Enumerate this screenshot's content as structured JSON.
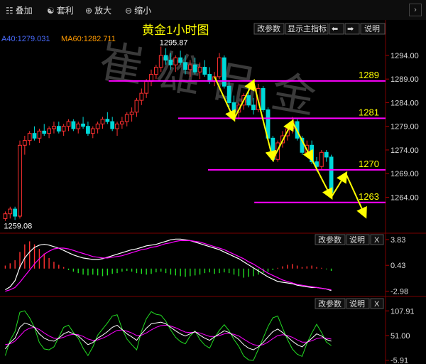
{
  "toolbar": {
    "overlay": "叠加",
    "arbitrage": "套利",
    "zoom_in": "放大",
    "zoom_out": "缩小",
    "next": "›"
  },
  "main_panel": {
    "title": "黄金1小时图",
    "ma_label_a": "A40:1279.031",
    "ma_label_b": "MA60:1282.711",
    "buttons": {
      "params": "改参数",
      "main_indicator": "显示主指标",
      "left": "⬅",
      "right": "➡",
      "help": "说明"
    },
    "watermark": "崔雄品金"
  },
  "macd_panel": {
    "buttons": {
      "params": "改参数",
      "help": "说明",
      "close": "X"
    }
  },
  "kdj_panel": {
    "buttons": {
      "params": "改参数",
      "help": "说明",
      "close": "X"
    }
  },
  "colors": {
    "up": "#ff3030",
    "down": "#00d8d8",
    "magenta": "#ff00ff",
    "yellow": "#ffff00",
    "white": "#ffffff",
    "green": "#22dd22"
  },
  "chart_data": [
    {
      "type": "candlestick",
      "title": "黄金1小时图",
      "ylim": [
        1257,
        1297
      ],
      "y_ticks": [
        1294.0,
        1289.0,
        1284.0,
        1279.0,
        1274.0,
        1269.0,
        1264.0
      ],
      "annotations": {
        "high": "1295.87",
        "low": "1259.08"
      },
      "ohlc": [
        [
          1259.5,
          1261,
          1259,
          1260.5
        ],
        [
          1260.5,
          1262,
          1259.5,
          1261.5
        ],
        [
          1261.5,
          1262,
          1259.2,
          1260
        ],
        [
          1260,
          1276,
          1259.5,
          1275
        ],
        [
          1275,
          1277,
          1273,
          1276
        ],
        [
          1276,
          1278,
          1275,
          1277.5
        ],
        [
          1277.5,
          1279,
          1276,
          1276.5
        ],
        [
          1276.5,
          1278.5,
          1275.5,
          1278
        ],
        [
          1278,
          1279.5,
          1277,
          1277.5
        ],
        [
          1277.5,
          1279,
          1276.5,
          1278.5
        ],
        [
          1278.5,
          1280,
          1277.5,
          1279
        ],
        [
          1279,
          1280,
          1277.5,
          1278
        ],
        [
          1278,
          1279.5,
          1277,
          1279
        ],
        [
          1279,
          1280.5,
          1278,
          1280
        ],
        [
          1280,
          1280.5,
          1278,
          1278.5
        ],
        [
          1278.5,
          1280,
          1277.5,
          1279.5
        ],
        [
          1279.5,
          1281,
          1278.5,
          1279
        ],
        [
          1279,
          1280,
          1277,
          1277.5
        ],
        [
          1277.5,
          1279,
          1276.5,
          1278.5
        ],
        [
          1278.5,
          1280,
          1277.5,
          1279.5
        ],
        [
          1279.5,
          1281,
          1278.5,
          1280.5
        ],
        [
          1280.5,
          1282,
          1279.5,
          1280
        ],
        [
          1280,
          1281,
          1278,
          1278.5
        ],
        [
          1278.5,
          1280,
          1277,
          1279.5
        ],
        [
          1279.5,
          1281,
          1278.5,
          1280
        ],
        [
          1280,
          1282,
          1279,
          1281.5
        ],
        [
          1281.5,
          1283,
          1280,
          1282
        ],
        [
          1282,
          1285,
          1281,
          1284.5
        ],
        [
          1284.5,
          1287,
          1283.5,
          1286
        ],
        [
          1286,
          1289,
          1285,
          1288.5
        ],
        [
          1288.5,
          1291,
          1287.5,
          1290
        ],
        [
          1290,
          1292,
          1289,
          1291.5
        ],
        [
          1291.5,
          1295.87,
          1290.5,
          1294
        ],
        [
          1294,
          1295.5,
          1292,
          1293
        ],
        [
          1293,
          1294.5,
          1291,
          1292
        ],
        [
          1292,
          1294,
          1290.5,
          1293.5
        ],
        [
          1293.5,
          1295,
          1292,
          1292.5
        ],
        [
          1292.5,
          1294,
          1290,
          1291
        ],
        [
          1291,
          1293,
          1289.5,
          1292
        ],
        [
          1292,
          1293.5,
          1290,
          1290.5
        ],
        [
          1290.5,
          1292.5,
          1289,
          1291.5
        ],
        [
          1291.5,
          1293,
          1289.5,
          1290
        ],
        [
          1290,
          1291.5,
          1288,
          1288.5
        ],
        [
          1288.5,
          1290.5,
          1287.5,
          1289.5
        ],
        [
          1289.5,
          1294.5,
          1289,
          1293.5
        ],
        [
          1293.5,
          1294,
          1287,
          1287.5
        ],
        [
          1287.5,
          1288.5,
          1283,
          1284
        ],
        [
          1284,
          1285.5,
          1281,
          1282
        ],
        [
          1282,
          1284,
          1280.5,
          1283.5
        ],
        [
          1283.5,
          1286,
          1282.5,
          1285.5
        ],
        [
          1285.5,
          1287,
          1283,
          1283.5
        ],
        [
          1283.5,
          1285,
          1281.5,
          1282.5
        ],
        [
          1282.5,
          1288,
          1282,
          1287
        ],
        [
          1287,
          1287.5,
          1282,
          1282.5
        ],
        [
          1282.5,
          1283,
          1276,
          1276.5
        ],
        [
          1276.5,
          1277,
          1271.5,
          1272
        ],
        [
          1272,
          1276,
          1271.5,
          1275.5
        ],
        [
          1275.5,
          1278,
          1274.5,
          1277
        ],
        [
          1277,
          1279.5,
          1276,
          1278.5
        ],
        [
          1278.5,
          1281,
          1277.5,
          1280
        ],
        [
          1280,
          1280.5,
          1276,
          1276.5
        ],
        [
          1276.5,
          1277,
          1273,
          1273.5
        ],
        [
          1273.5,
          1276,
          1272.5,
          1275
        ],
        [
          1275,
          1276,
          1271,
          1271.5
        ],
        [
          1271.5,
          1272.5,
          1269.5,
          1270.5
        ],
        [
          1270.5,
          1274,
          1270,
          1273.5
        ],
        [
          1273.5,
          1274,
          1271.5,
          1272.5
        ],
        [
          1272.5,
          1273,
          1264.5,
          1265
        ]
      ],
      "horizontal_levels": [
        {
          "label": "1289",
          "value": 1288.6,
          "x_start_frac": 0.32
        },
        {
          "label": "1281",
          "value": 1280.7,
          "x_start_frac": 0.53
        },
        {
          "label": "1270",
          "value": 1269.8,
          "x_start_frac": 0.62
        },
        {
          "label": "1263",
          "value": 1262.9,
          "x_start_frac": 0.76
        }
      ],
      "projection_path": [
        [
          43,
          1289.5
        ],
        [
          47,
          1280.5
        ],
        [
          51,
          1288.5
        ],
        [
          55,
          1272
        ],
        [
          59,
          1280
        ],
        [
          63,
          1272
        ],
        [
          67,
          1264
        ],
        [
          70,
          1269
        ],
        [
          74,
          1260
        ]
      ]
    },
    {
      "type": "macd",
      "y_ticks": [
        3.83,
        0.43,
        -2.98
      ],
      "ylim": [
        -3.4,
        4.3
      ],
      "hist": [
        0.4,
        0.7,
        1.1,
        2.2,
        3.2,
        3.6,
        3.2,
        2.6,
        2.0,
        1.4,
        0.9,
        0.5,
        0.2,
        -0.2,
        -0.4,
        -0.6,
        -0.8,
        -0.9,
        -0.8,
        -0.9,
        -1.0,
        -0.9,
        -0.7,
        -0.6,
        -0.4,
        -0.3,
        -0.4,
        -0.6,
        -0.7,
        -0.8,
        -0.7,
        -0.5,
        -0.4,
        -0.6,
        -0.8,
        -0.9,
        -1.0,
        -1.1,
        -1.0,
        -0.9,
        -0.8,
        -0.6,
        -0.5,
        -0.7,
        -0.6,
        -0.5,
        -0.6,
        -0.8,
        -1.0,
        -1.2,
        -1.1,
        -1.0,
        -0.8,
        -0.6,
        -0.4,
        -0.2,
        0.1,
        0.3,
        0.5,
        0.6,
        0.4,
        0.2,
        0.3,
        0.4,
        0.2,
        0.1,
        -0.1,
        -0.3
      ],
      "dif": [
        -2.8,
        -2.4,
        -1.6,
        0.2,
        1.4,
        2.2,
        2.8,
        3.1,
        3.2,
        3.1,
        2.9,
        2.7,
        2.4,
        2.1,
        1.8,
        1.6,
        1.4,
        1.3,
        1.2,
        1.2,
        1.3,
        1.5,
        1.7,
        1.9,
        2.1,
        2.3,
        2.5,
        2.6,
        2.8,
        3.0,
        3.1,
        3.2,
        3.4,
        3.6,
        3.8,
        3.9,
        3.9,
        3.8,
        3.7,
        3.5,
        3.3,
        3.1,
        2.9,
        2.7,
        2.5,
        2.2,
        1.9,
        1.6,
        1.3,
        0.9,
        0.5,
        0.1,
        -0.3,
        -0.7,
        -1.1,
        -1.4,
        -1.7,
        -1.8,
        -1.9,
        -2.0,
        -2.2,
        -2.3,
        -2.4,
        -2.5,
        -2.5,
        -2.6,
        -2.7,
        -2.9
      ],
      "dea": [
        -3.0,
        -2.8,
        -2.5,
        -1.8,
        -1.0,
        -0.2,
        0.6,
        1.3,
        1.9,
        2.3,
        2.6,
        2.7,
        2.7,
        2.6,
        2.4,
        2.2,
        2.0,
        1.8,
        1.6,
        1.5,
        1.4,
        1.4,
        1.5,
        1.6,
        1.7,
        1.9,
        2.1,
        2.3,
        2.5,
        2.6,
        2.8,
        2.9,
        3.1,
        3.3,
        3.4,
        3.6,
        3.7,
        3.7,
        3.7,
        3.6,
        3.5,
        3.3,
        3.1,
        2.9,
        2.7,
        2.5,
        2.2,
        1.9,
        1.6,
        1.3,
        0.9,
        0.6,
        0.2,
        -0.2,
        -0.6,
        -0.9,
        -1.2,
        -1.5,
        -1.7,
        -1.9,
        -2.1,
        -2.2,
        -2.3,
        -2.4,
        -2.5,
        -2.6,
        -2.7,
        -2.8
      ]
    },
    {
      "type": "kdj",
      "y_ticks": [
        107.91,
        51.0,
        -5.91
      ],
      "ylim": [
        -8,
        110
      ],
      "k": [
        20,
        35,
        45,
        70,
        80,
        76,
        70,
        55,
        45,
        40,
        38,
        45,
        55,
        60,
        55,
        50,
        40,
        30,
        35,
        45,
        52,
        60,
        70,
        75,
        65,
        55,
        48,
        40,
        55,
        68,
        78,
        80,
        82,
        78,
        70,
        62,
        55,
        50,
        55,
        60,
        52,
        45,
        40,
        48,
        55,
        62,
        58,
        50,
        42,
        30,
        22,
        18,
        25,
        35,
        48,
        60,
        66,
        58,
        48,
        38,
        30,
        25,
        35,
        45,
        55,
        50,
        42,
        38
      ],
      "d": [
        30,
        32,
        38,
        50,
        62,
        68,
        70,
        65,
        57,
        50,
        45,
        44,
        47,
        52,
        54,
        53,
        49,
        43,
        40,
        41,
        45,
        50,
        57,
        63,
        64,
        61,
        57,
        51,
        52,
        57,
        64,
        70,
        74,
        75,
        73,
        69,
        64,
        59,
        58,
        59,
        57,
        53,
        49,
        49,
        51,
        55,
        56,
        54,
        50,
        43,
        36,
        30,
        28,
        30,
        36,
        44,
        51,
        53,
        51,
        47,
        41,
        36,
        36,
        39,
        44,
        46,
        45,
        43
      ],
      "j": [
        5,
        40,
        60,
        105,
        108,
        92,
        70,
        35,
        20,
        18,
        25,
        47,
        70,
        75,
        58,
        45,
        22,
        5,
        25,
        52,
        66,
        80,
        96,
        99,
        67,
        43,
        30,
        18,
        61,
        90,
        106,
        100,
        98,
        84,
        64,
        47,
        37,
        32,
        50,
        62,
        42,
        29,
        22,
        46,
        63,
        76,
        62,
        42,
        26,
        4,
        -5,
        -6,
        19,
        45,
        72,
        92,
        96,
        68,
        42,
        20,
        8,
        3,
        33,
        57,
        77,
        58,
        36,
        28
      ]
    }
  ]
}
